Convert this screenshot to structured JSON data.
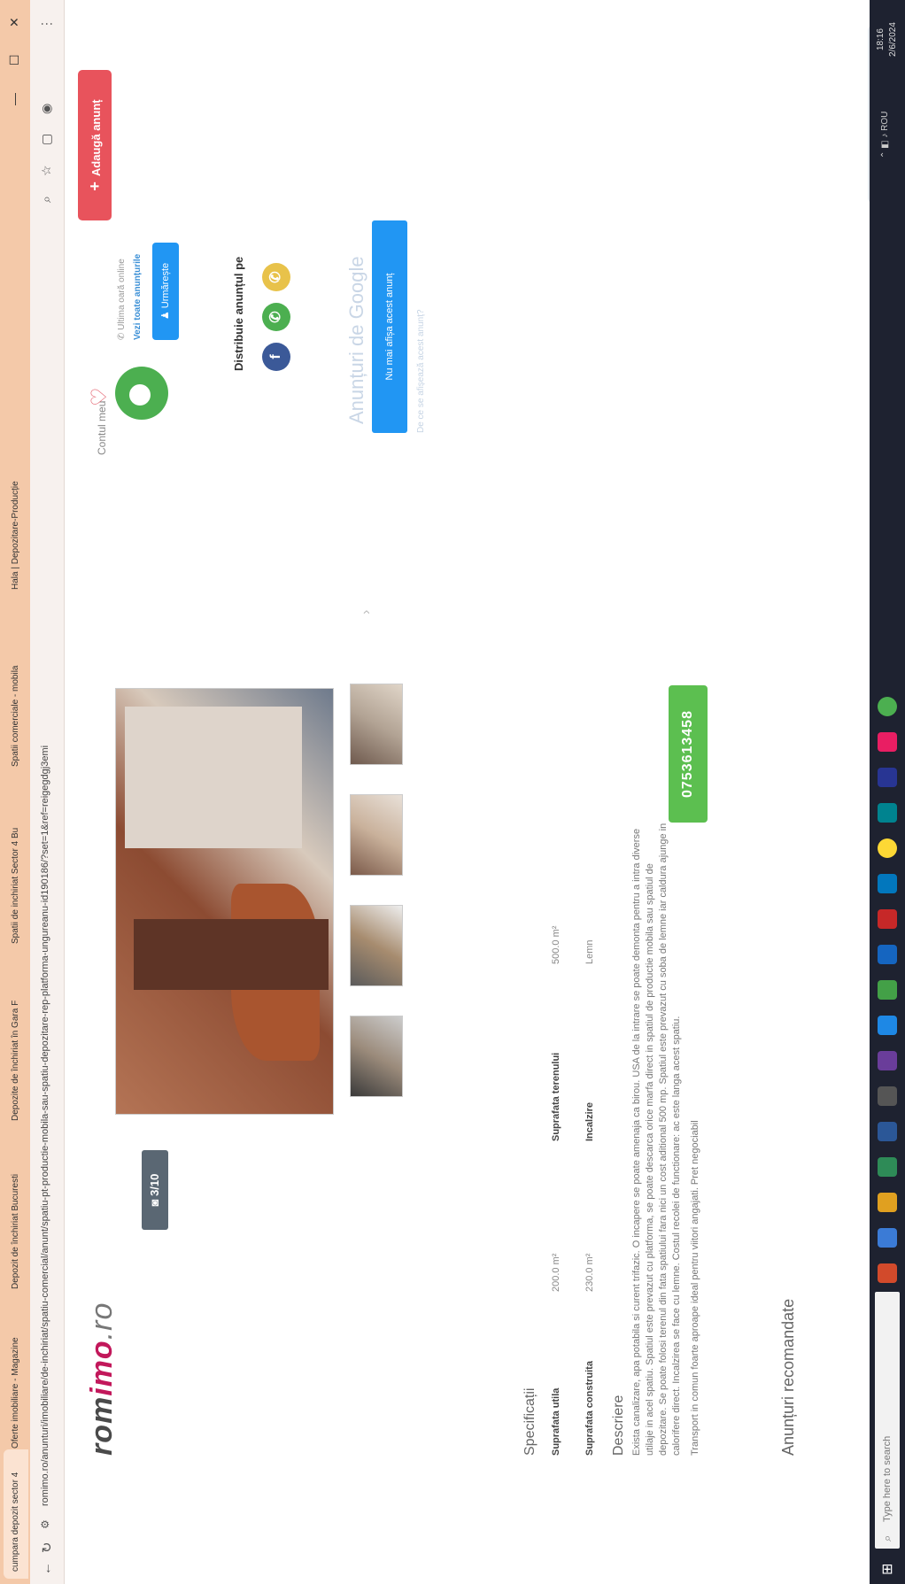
{
  "browser": {
    "tabs": [
      {
        "label": "cumpara depozit sector 4"
      },
      {
        "label": "Oferte imobiliare - Magazine"
      },
      {
        "label": "Depozit de închiriat Bucuresti"
      },
      {
        "label": "Depozite de închiriat în Gara F"
      },
      {
        "label": "Spatii de inchiriat Sector 4 Bu"
      },
      {
        "label": "Spatii comerciale - mobila"
      },
      {
        "label": "Hala | Depozitare-Producție"
      }
    ],
    "url": "romimo.ro/anunturi/imobiliare/de-inchiriat/spatiu-comercial/anunt/spatiu-pt-productie-mobila-sau-spatiu-depozitare-rep-platforma-ungureanu-id190186/?set=1&ref=reigegdgj3emi",
    "window_controls": [
      "—",
      "☐",
      "✕"
    ]
  },
  "header": {
    "logo_prefix": "rom",
    "logo_highlight": "imo",
    "logo_suffix": ".ro",
    "account_label": "Contul meu",
    "add_listing_label": "Adaugă anunț"
  },
  "gallery": {
    "counter": "3/10"
  },
  "specs": {
    "title": "Specificații",
    "rows": [
      {
        "label": "Suprafata utila",
        "value": "200.0 m²",
        "label2": "Suprafata terenului",
        "value2": "500.0 m²"
      },
      {
        "label": "Suprafata construita",
        "value": "230.0 m²",
        "label2": "Incalzire",
        "value2": "Lemn"
      }
    ]
  },
  "description": {
    "title": "Descriere",
    "paragraphs": [
      "Exista canalizare, apa potabila si curent trifazic. O incapere se poate amenaja ca birou. USA de la intrare se poate demonta pentru a intra diverse utilaje in acel spatiu. Spatiul este prevazut cu platforma, se poate descarca orice marfa direct in spatiul de productie mobila sau spatiul de depozitare. Se poate folosi terenul din fata spatiului fara nici un cost aditional 500 mp. Spatiul este prevazut cu soba de lemne iar caldura ajunge in calorifere direct. Incalzirea se face cu lemne. Costul recolei de functionare: ac este langa acest spatiu.",
      "Transport in comun foarte aproape ideal pentru viitori angajati. Pret negociabil"
    ]
  },
  "phone": "0753613458",
  "recommended_title": "Anunțuri recomandate",
  "seller": {
    "online": "Ultima oară online",
    "all_ads": "Vezi toate anunțurile",
    "follow": "Urmărește"
  },
  "share": {
    "label": "Distribuie anunțul pe",
    "icons": [
      "facebook-icon",
      "whatsapp-icon",
      "viber-icon"
    ]
  },
  "google_ads": {
    "title": "Anunțuri de Google",
    "button": "Nu mai afișa acest anunț",
    "note": "De ce se afișează acest anunț?"
  },
  "taskbar": {
    "search_placeholder": "Type here to search",
    "clock_time": "18:16",
    "clock_date": "2/6/2024",
    "tray_lang": "ROU"
  },
  "colors": {
    "brand_pink": "#c2185b",
    "add_button": "#e8535c",
    "phone_button": "#5cbf50",
    "follow_button": "#2196f3",
    "tab_bar": "#f4c9a9"
  }
}
